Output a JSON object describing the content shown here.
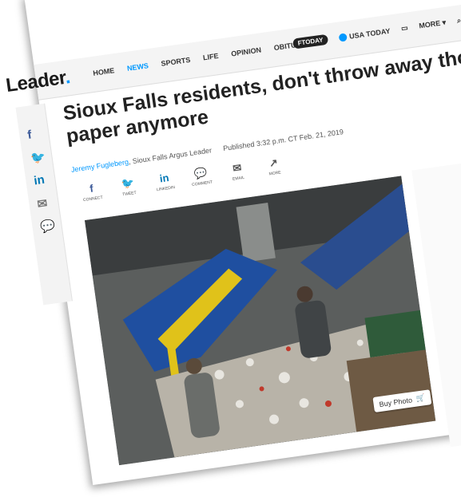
{
  "logo": {
    "text": "Leader",
    "dot": "."
  },
  "nav": {
    "links": [
      "HOME",
      "NEWS",
      "SPORTS",
      "LIFE",
      "OPINION",
      "OBITUARIES"
    ],
    "active_index": 1,
    "ftoday": "FTODAY",
    "usatoday": "USA TODAY",
    "more": "MORE"
  },
  "article": {
    "title": "Sioux Falls residents, don't throw away those paper anymore",
    "author": "Jeremy Fugleberg",
    "outlet": ", Sioux Falls Argus Leader",
    "published": "Published 3:32 p.m. CT Feb. 21, 2019"
  },
  "share": [
    {
      "icon": "f",
      "label": "CONNECT",
      "color": "#3b5998"
    },
    {
      "icon": "🐦",
      "label": "TWEET",
      "color": "#1da1f2"
    },
    {
      "icon": "in",
      "label": "LINKEDIN",
      "color": "#0077b5"
    },
    {
      "icon": "💬",
      "label": "COMMENT",
      "color": "#555555"
    },
    {
      "icon": "✉",
      "label": "EMAIL",
      "color": "#555555"
    },
    {
      "icon": "↗",
      "label": "MORE",
      "color": "#555555"
    }
  ],
  "sidebar_icons": [
    {
      "glyph": "f",
      "color": "#3b5998"
    },
    {
      "glyph": "🐦",
      "color": "#1da1f2"
    },
    {
      "glyph": "in",
      "color": "#0077b5"
    },
    {
      "glyph": "✉",
      "color": "#777777"
    },
    {
      "glyph": "💬",
      "color": "#777777"
    }
  ],
  "photo": {
    "buy_label": "Buy Photo"
  }
}
